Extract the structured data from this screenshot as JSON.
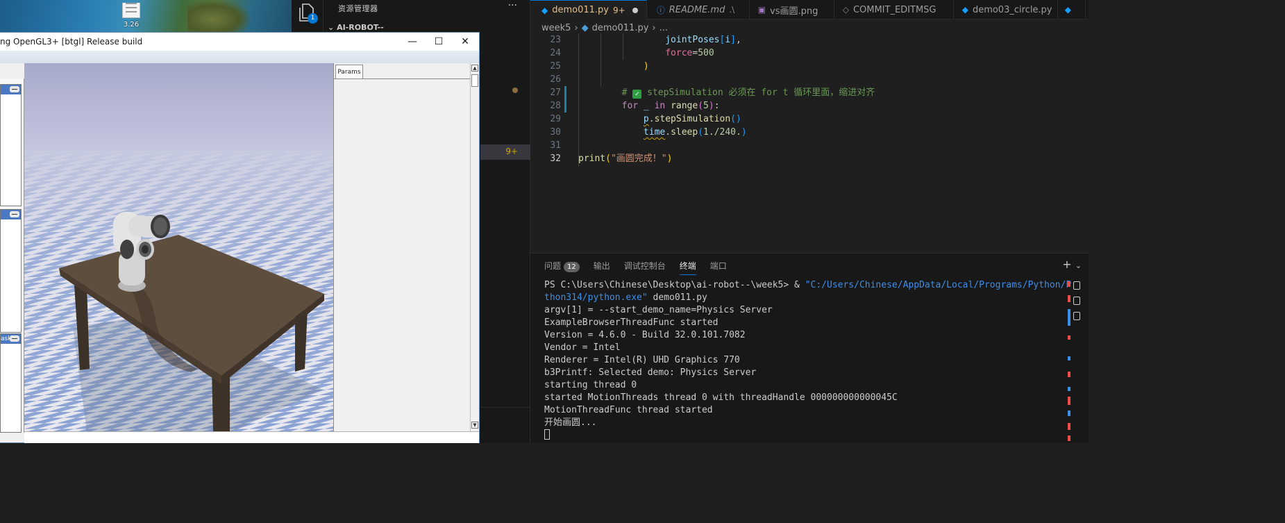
{
  "desktop": {
    "file_label": "3.26"
  },
  "activity": {
    "explorer_badge": "1"
  },
  "explorer": {
    "title": "资源管理器",
    "more": "···",
    "section": "AI-ROBOT--",
    "problem_badge": "9+"
  },
  "tabs": [
    {
      "name": "demo011.py",
      "status": "9+",
      "active": true
    },
    {
      "name": "README.md",
      "detail": ".\\"
    },
    {
      "name": "vs画圆.png"
    },
    {
      "name": "COMMIT_EDITMSG"
    },
    {
      "name": "demo03_circle.py"
    }
  ],
  "breadcrumb": {
    "folder": "week5",
    "file": "demo011.py",
    "tail": "..."
  },
  "code": {
    "l23": "23",
    "l24": "24",
    "l25": "25",
    "l26": "26",
    "l27": "27",
    "l28": "28",
    "l29": "29",
    "l30": "30",
    "l31": "31",
    "l32": "32",
    "joint_poses": "jointPoses",
    "index_i": "i",
    "force_kw": "force",
    "force_val": "500",
    "comment_text": " stepSimulation 必须在 for t 循环里面，缩进对齐",
    "for_kw": "for",
    "underscore": "_",
    "in_kw": "in",
    "range_fn": "range",
    "range_arg": "5",
    "p_obj": "p",
    "step_fn": "stepSimulation",
    "time_obj": "time",
    "sleep_fn": "sleep",
    "sleep_arg": "1./240.",
    "print_fn": "print",
    "print_str": "\"画圆完成！\""
  },
  "panel": {
    "tabs": [
      {
        "label": "问题",
        "count": "12"
      },
      {
        "label": "输出"
      },
      {
        "label": "调试控制台"
      },
      {
        "label": "终端",
        "active": true
      },
      {
        "label": "端口"
      }
    ],
    "plus": "+"
  },
  "terminal": {
    "prompt": "PS C:\\Users\\Chinese\\Desktop\\ai-robot--\\week5> & ",
    "exe_path_1": "\"C:/Users/Chinese/AppData/Local/Programs/Python/Py",
    "exe_path_2": "thon314/python.exe\"",
    "script": " demo011.py",
    "lines": [
      "argv[1] = --start_demo_name=Physics Server",
      "ExampleBrowserThreadFunc started",
      "Version = 4.6.0 - Build 32.0.101.7082",
      "Vendor = Intel",
      "Renderer = Intel(R) UHD Graphics 770",
      "b3Printf: Selected demo: Physics Server",
      "starting thread 0",
      "started MotionThreads thread 0 with threadHandle 000000000000045C",
      "MotionThreadFunc thread started",
      "开始画圆..."
    ]
  },
  "bullet_window": {
    "title": "ng OpenGL3+ [btgl] Release build",
    "params_tab": "Params",
    "side_label": "ask",
    "minimize": "—",
    "maximize": "☐",
    "close": "✕"
  },
  "colors": {
    "accent": "#0078d4",
    "modified_tab": "#e2c08d",
    "viewport_sky": "#9fa3c4",
    "floor_blue": "#8aa2d4",
    "table_top": "#5a4a3a"
  }
}
